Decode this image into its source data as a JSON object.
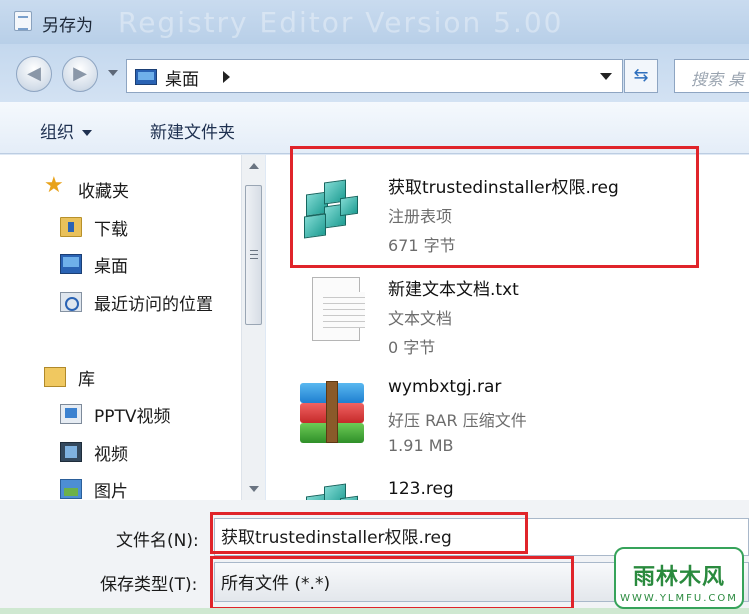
{
  "window": {
    "title": "另存为",
    "background_title": "Registry Editor Version 5.00"
  },
  "nav": {
    "back_glyph": "◀",
    "forward_glyph": "▶",
    "address_crumb": "桌面",
    "refresh_glyph": "⇆",
    "search_placeholder": "搜索 桌"
  },
  "toolbar": {
    "organize_label": "组织",
    "new_folder_label": "新建文件夹"
  },
  "sidebar": {
    "favorites_label": "收藏夹",
    "favorites": [
      {
        "label": "下载",
        "icon": "download-folder-icon"
      },
      {
        "label": "桌面",
        "icon": "desktop-icon"
      },
      {
        "label": "最近访问的位置",
        "icon": "recent-places-icon"
      }
    ],
    "libraries_label": "库",
    "libraries": [
      {
        "label": "PPTV视频",
        "icon": "pptv-icon"
      },
      {
        "label": "视频",
        "icon": "video-library-icon"
      },
      {
        "label": "图片",
        "icon": "picture-library-icon"
      }
    ]
  },
  "files": [
    {
      "name": "获取trustedinstaller权限.reg",
      "type": "注册表项",
      "size": "671 字节",
      "icon": "registry-file-icon"
    },
    {
      "name": "新建文本文档.txt",
      "type": "文本文档",
      "size": "0 字节",
      "icon": "text-file-icon"
    },
    {
      "name": "wymbxtgj.rar",
      "type": "好压 RAR 压缩文件",
      "size": "1.91 MB",
      "icon": "rar-archive-icon"
    },
    {
      "name": "123.reg",
      "type": "",
      "size": "",
      "icon": "registry-file-icon"
    }
  ],
  "form": {
    "filename_label": "文件名(N):",
    "filename_value": "获取trustedinstaller权限.reg",
    "filetype_label": "保存类型(T):",
    "filetype_value": "所有文件  (*.*)"
  },
  "watermark": {
    "brand": "雨林木风",
    "url": "WWW.YLMFU.COM"
  },
  "colors": {
    "highlight": "#e0242a",
    "titlebar": "#c9dbef"
  }
}
